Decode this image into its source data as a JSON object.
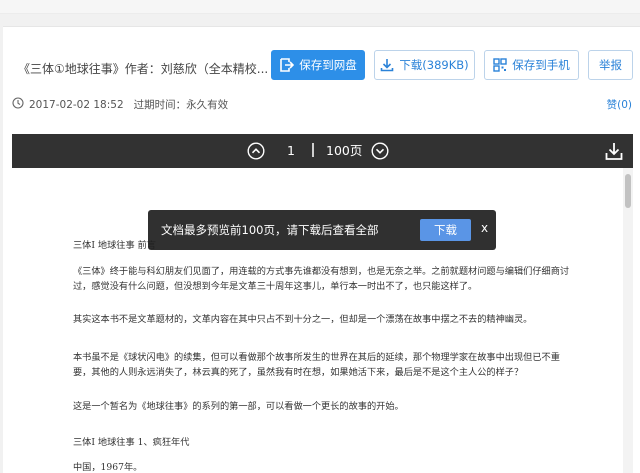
{
  "header": {
    "title": "《三体①地球往事》作者：刘慈欣（全本精校...",
    "save_to_netdisk_label": "保存到网盘",
    "download_label": "下载(389KB)",
    "save_to_phone_label": "保存到手机",
    "report_label": "举报"
  },
  "meta": {
    "date": "2017-02-02 18:52",
    "expire": "过期时间：永久有效",
    "like": "赞(0)"
  },
  "viewer": {
    "current_page": "1",
    "total_pages": "100页"
  },
  "toast": {
    "message": "文档最多预览前100页，请下载后查看全部",
    "download_label": "下载",
    "close_label": "x"
  },
  "document": {
    "paragraphs": [
      "三体Ⅰ 地球往事 前言",
      "《三体》终于能与科幻朋友们见面了，用连载的方式事先谁都没有想到，也是无奈之举。之前就题材问题与编辑们仔细商讨过，感觉没有什么问题，但没想到今年是文革三十周年这事儿，单行本一时出不了，也只能这样了。",
      "其实这本书不是文革题材的，文革内容在其中只占不到十分之一，但却是一个漂荡在故事中摆之不去的精神幽灵。",
      "本书虽不是《球状闪电》的续集，但可以看做那个故事所发生的世界在其后的延续，那个物理学家在故事中出现但已不重要，其他的人则永远消失了，林云真的死了，虽然我有时在想，如果她活下来，最后是不是这个主人公的样子？",
      "这是一个暂名为《地球往事》的系列的第一部，可以看做一个更长的故事的开始。",
      "三体Ⅰ 地球往事 1、疯狂年代",
      "中国，1967年。"
    ]
  },
  "colors": {
    "primary": "#2d8fe8",
    "link": "#2a82d8",
    "viewer_bar": "#323232",
    "toast_button": "#5a95e6"
  }
}
